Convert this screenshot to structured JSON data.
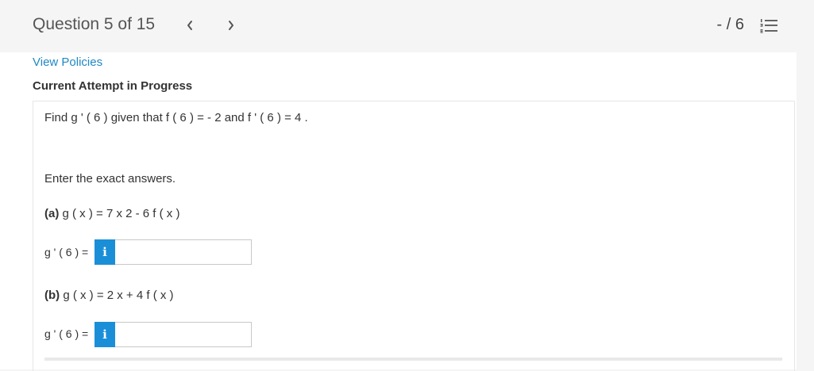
{
  "header": {
    "question_title": "Question 5 of 15",
    "score": "- / 6",
    "prev_icon": "chevron-left-icon",
    "next_icon": "chevron-right-icon",
    "list_icon": "numbered-list-icon"
  },
  "links": {
    "view_policies": "View Policies"
  },
  "status": {
    "attempt": "Current Attempt in Progress"
  },
  "question": {
    "prompt": "Find g ' ( 6 ) given that f ( 6 ) = - 2 and f ' ( 6 ) = 4 .",
    "instructions": "Enter the exact answers.",
    "parts": [
      {
        "label": "(a)",
        "expression": " g ( x ) = 7 x 2 - 6 f ( x )",
        "answer_label": "g ' ( 6 ) =",
        "info_icon": "info-icon",
        "value": ""
      },
      {
        "label": "(b)",
        "expression": " g ( x ) = 2 x + 4 f ( x )",
        "answer_label": "g ' ( 6 ) =",
        "info_icon": "info-icon",
        "value": ""
      }
    ],
    "info_glyph": "i"
  }
}
